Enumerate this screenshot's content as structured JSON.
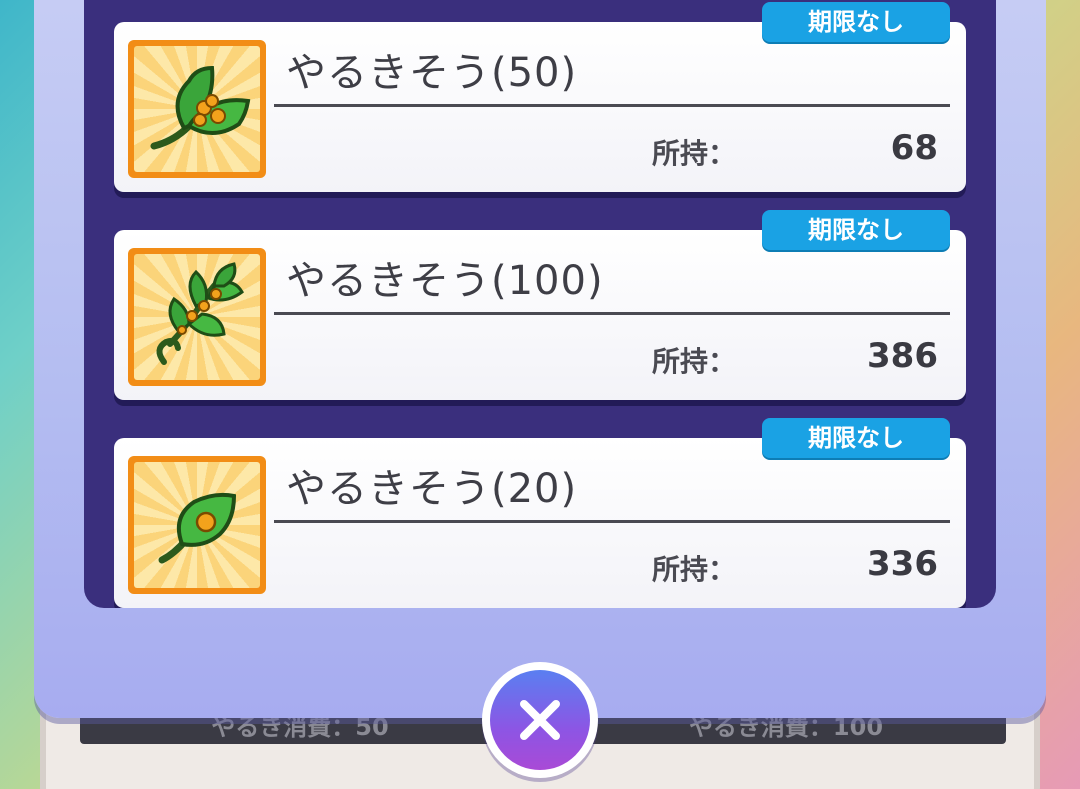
{
  "background": {
    "left_bar_text": "やるき消費：50",
    "right_bar_text": "やるき消費：100"
  },
  "items": [
    {
      "name": "やるきそう(50)",
      "badge": "期限なし",
      "owned_label": "所持：",
      "owned_value": "68",
      "icon": "leaf-cluster-icon"
    },
    {
      "name": "やるきそう(100)",
      "badge": "期限なし",
      "owned_label": "所持：",
      "owned_value": "386",
      "icon": "leaf-branch-icon"
    },
    {
      "name": "やるきそう(20)",
      "badge": "期限なし",
      "owned_label": "所持：",
      "owned_value": "336",
      "icon": "single-leaf-icon"
    }
  ],
  "close_button": {
    "icon": "close-icon"
  },
  "colors": {
    "panel": "#3a2f7d",
    "badge": "#1aa2e4",
    "modal": "#b4bdf1",
    "icon_frame": "#f28d16"
  }
}
